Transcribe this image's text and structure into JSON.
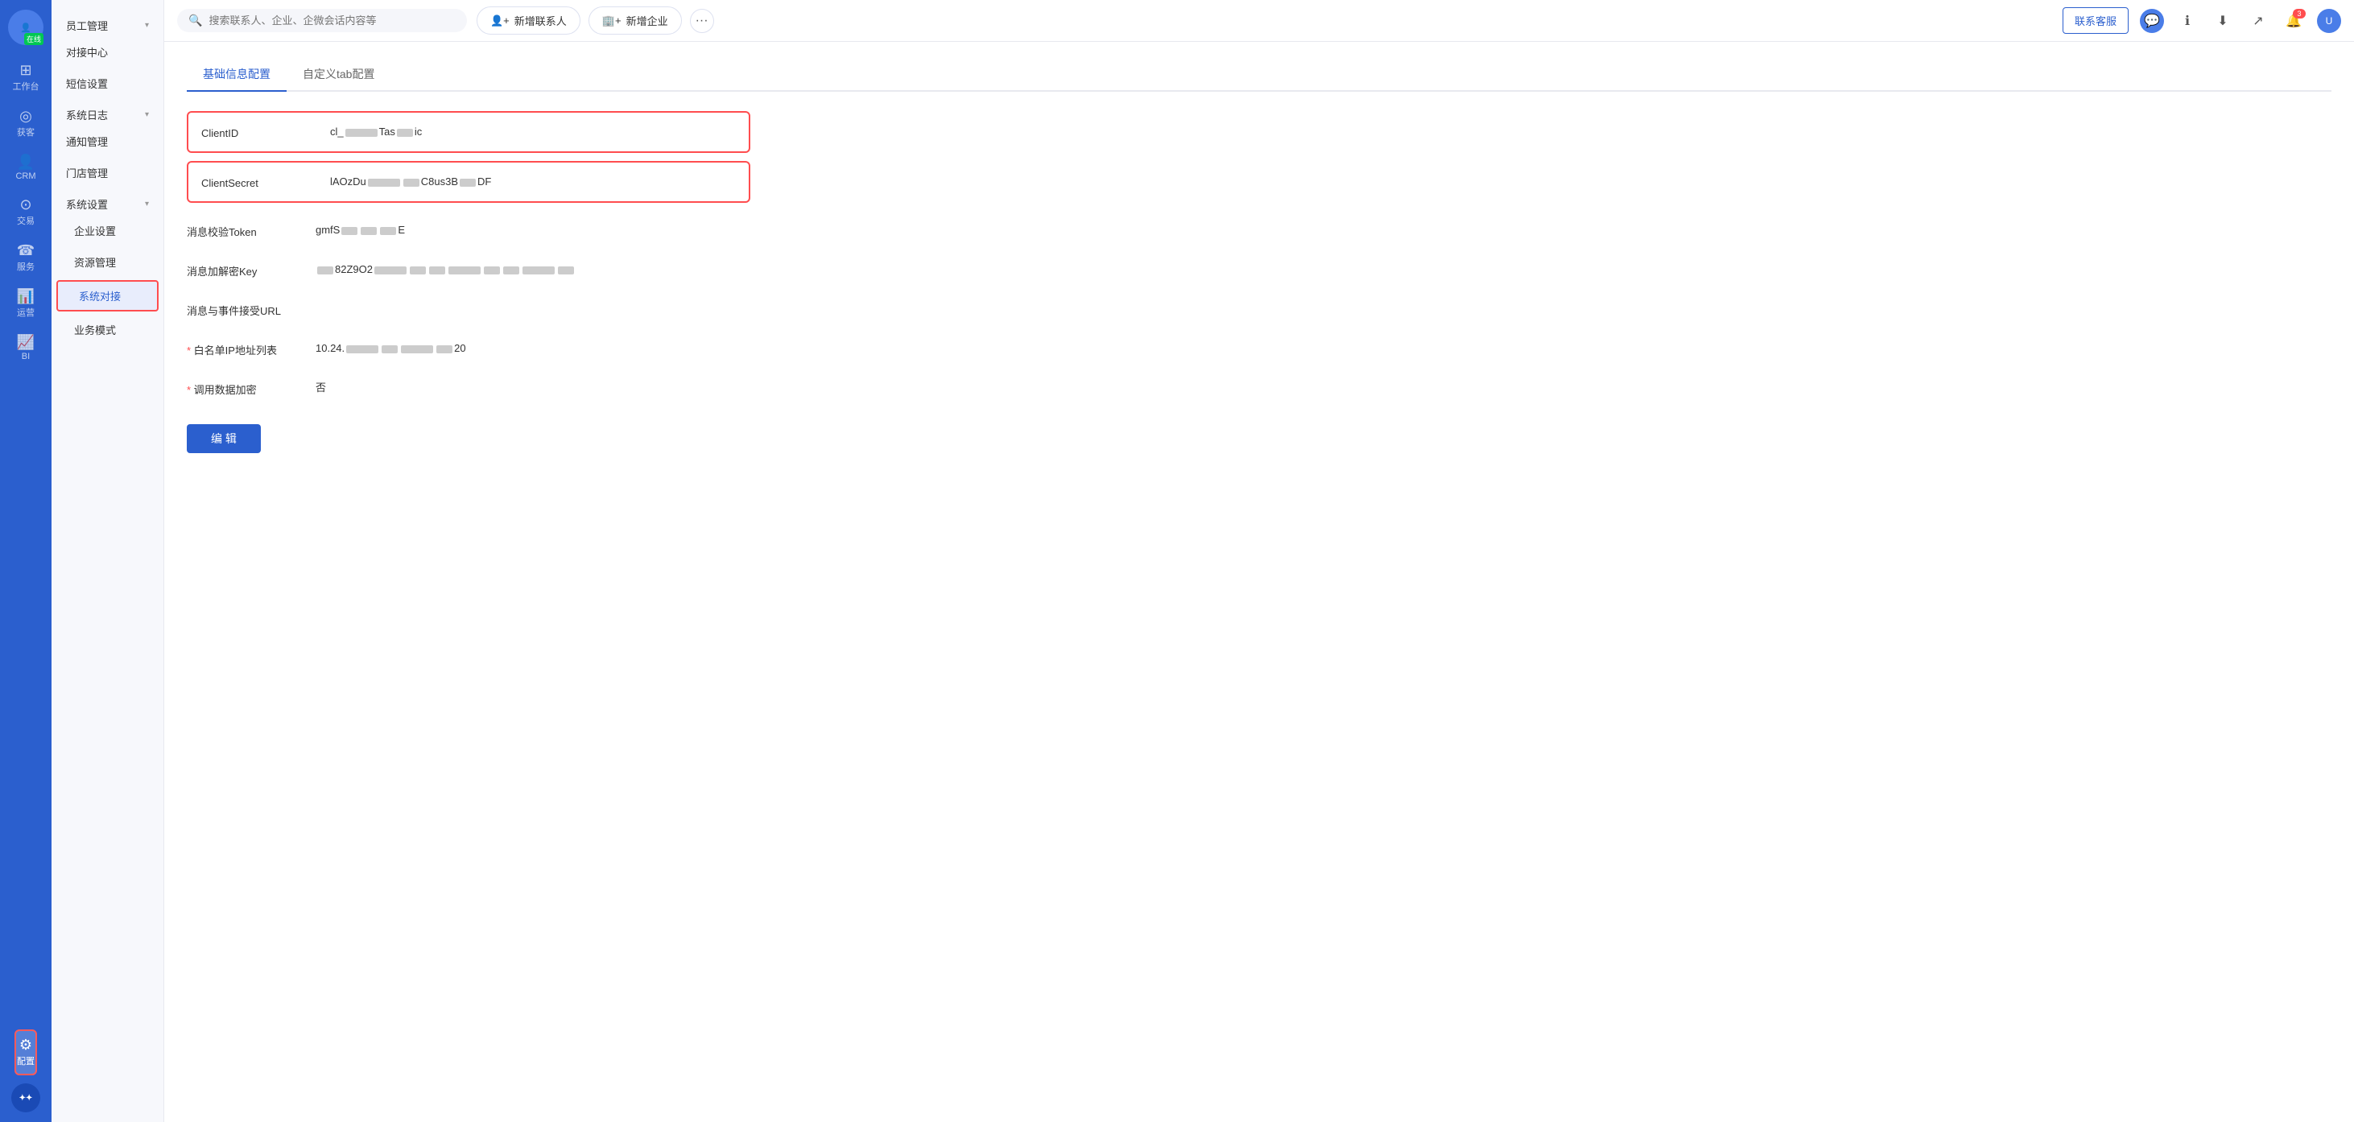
{
  "sidebar": {
    "avatar": {
      "label": "在线",
      "status": "在线"
    },
    "items": [
      {
        "id": "workbench",
        "label": "工作台",
        "icon": "⊞"
      },
      {
        "id": "leads",
        "label": "获客",
        "icon": "◎"
      },
      {
        "id": "crm",
        "label": "CRM",
        "icon": "👤"
      },
      {
        "id": "transactions",
        "label": "交易",
        "icon": "⊙"
      },
      {
        "id": "service",
        "label": "服务",
        "icon": "☎"
      },
      {
        "id": "operations",
        "label": "运营",
        "icon": "📊"
      },
      {
        "id": "bi",
        "label": "BI",
        "icon": "📈"
      },
      {
        "id": "settings",
        "label": "配置",
        "icon": "⚙",
        "active": true
      }
    ],
    "logo": "RAi"
  },
  "secondary_nav": {
    "items": [
      {
        "id": "employee-mgmt",
        "label": "员工管理",
        "has_arrow": true,
        "expanded": true
      },
      {
        "id": "connection-center",
        "label": "对接中心",
        "has_arrow": false
      },
      {
        "id": "sms-settings",
        "label": "短信设置",
        "has_arrow": false
      },
      {
        "id": "system-log",
        "label": "系统日志",
        "has_arrow": true,
        "expanded": true
      },
      {
        "id": "notification-mgmt",
        "label": "通知管理",
        "has_arrow": false
      },
      {
        "id": "store-mgmt",
        "label": "门店管理",
        "has_arrow": false
      },
      {
        "id": "system-settings",
        "label": "系统设置",
        "has_arrow": true,
        "expanded": true
      },
      {
        "id": "enterprise-settings",
        "label": "企业设置",
        "is_child": true
      },
      {
        "id": "resource-mgmt",
        "label": "资源管理",
        "is_child": true
      },
      {
        "id": "system-connect",
        "label": "系统对接",
        "is_child": true,
        "active": true,
        "highlighted": true
      },
      {
        "id": "business-mode",
        "label": "业务模式",
        "is_child": true
      }
    ]
  },
  "topbar": {
    "search_placeholder": "搜索联系人、企业、企微会话内容等",
    "btn_add_contact": "新增联系人",
    "btn_add_enterprise": "新增企业",
    "btn_customer_service": "联系客服",
    "notification_count": "3"
  },
  "page": {
    "tabs": [
      {
        "id": "basic-config",
        "label": "基础信息配置",
        "active": true
      },
      {
        "id": "custom-tab",
        "label": "自定义tab配置",
        "active": false
      }
    ],
    "fields": [
      {
        "id": "client-id",
        "label": "ClientID",
        "value_prefix": "cl_",
        "value_middle": "Tas",
        "value_suffix": "ic",
        "highlighted": true,
        "has_masked": true
      },
      {
        "id": "client-secret",
        "label": "ClientSecret",
        "value_prefix": "lAOzDu",
        "value_middle": "C8us3B",
        "value_suffix": "DF",
        "highlighted": true,
        "has_masked": true
      },
      {
        "id": "verify-token",
        "label": "消息校验Token",
        "value_prefix": "gmfS",
        "value_suffix": "E",
        "has_masked": true
      },
      {
        "id": "decrypt-key",
        "label": "消息加解密Key",
        "value_prefix": "",
        "value_middle": "82Z9O2",
        "has_masked": true
      },
      {
        "id": "receive-url",
        "label": "消息与事件接受URL",
        "value": ""
      },
      {
        "id": "whitelist-ip",
        "label": "白名单IP地址列表",
        "value_prefix": "10.24.",
        "value_suffix": "20",
        "required": true,
        "has_masked": true
      },
      {
        "id": "data-encrypt",
        "label": "调用数据加密",
        "value": "否",
        "required": true
      }
    ],
    "edit_button": "编 辑"
  }
}
